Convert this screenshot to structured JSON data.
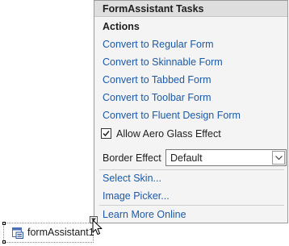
{
  "panel": {
    "title": "FormAssistant Tasks",
    "section_title": "Actions",
    "actions": [
      "Convert to Regular Form",
      "Convert to Skinnable Form",
      "Convert to Tabbed Form",
      "Convert to Toolbar Form",
      "Convert to Fluent Design Form"
    ],
    "aero_checkbox": {
      "label": "Allow Aero Glass Effect",
      "checked": true
    },
    "border_effect": {
      "label": "Border Effect",
      "selected": "Default"
    },
    "links": [
      "Select Skin...",
      "Image Picker..."
    ],
    "footer_link": "Learn More Online"
  },
  "component": {
    "name": "formAssistant1",
    "icon": "form-assistant-icon"
  },
  "icons": {
    "smart_tag": "smart-tag-arrow-icon",
    "cursor": "mouse-pointer-icon",
    "checkmark": "checkmark-icon",
    "dropdown": "chevron-down-icon"
  },
  "colors": {
    "link": "#1c5aa8",
    "panel_background": "#f4f4f4",
    "header_background": "#dedede"
  }
}
